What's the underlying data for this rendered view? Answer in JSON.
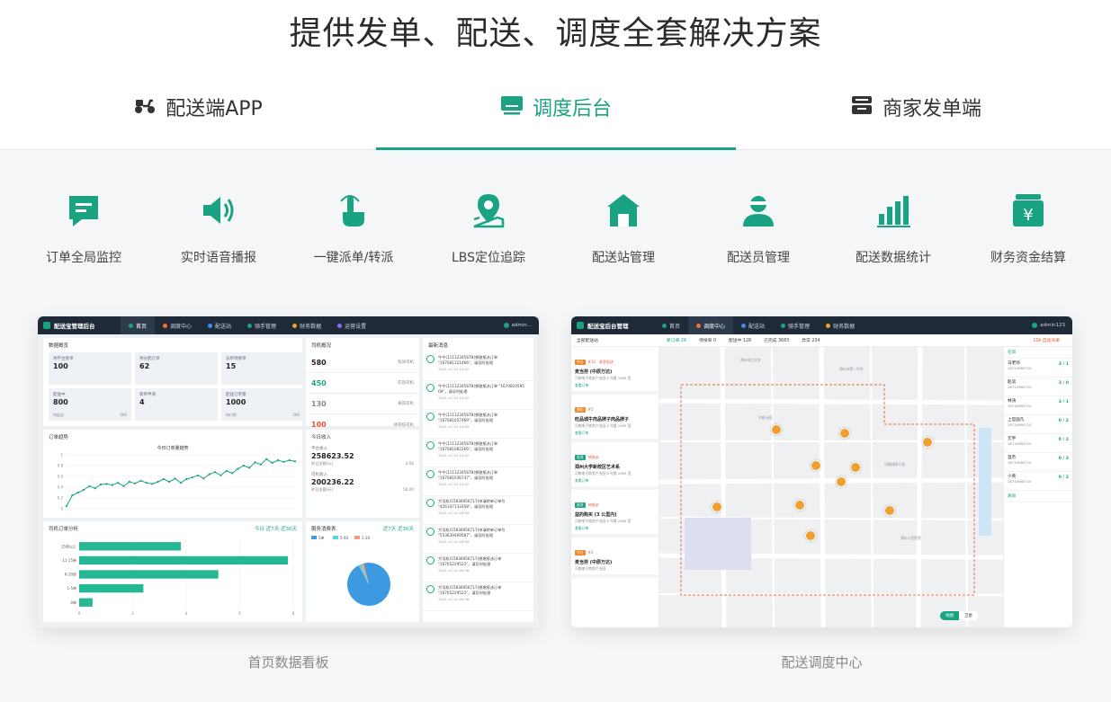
{
  "hero": {
    "title": "提供发单、配送、调度全套解决方案"
  },
  "tabs": [
    {
      "label": "配送端APP",
      "icon": "scooter-icon",
      "active": false
    },
    {
      "label": "调度后台",
      "icon": "monitor-icon",
      "active": true
    },
    {
      "label": "商家发单端",
      "icon": "register-icon",
      "active": false
    }
  ],
  "colors": {
    "accent": "#1aa383",
    "dark_nav": "#1f2a38",
    "orange": "#f0a030"
  },
  "features": [
    {
      "label": "订单全局监控",
      "icon": "order-doc-icon"
    },
    {
      "label": "实时语音播报",
      "icon": "speaker-icon"
    },
    {
      "label": "一键派单/转派",
      "icon": "tap-hand-icon"
    },
    {
      "label": "LBS定位追踪",
      "icon": "location-pin-icon"
    },
    {
      "label": "配送站管理",
      "icon": "station-house-icon"
    },
    {
      "label": "配送员管理",
      "icon": "courier-avatar-icon"
    },
    {
      "label": "配送数据统计",
      "icon": "bar-stats-icon"
    },
    {
      "label": "财务资金结算",
      "icon": "wallet-yen-icon"
    }
  ],
  "screenshots": {
    "dashboard": {
      "caption": "首页数据看板",
      "appbar": {
        "brand": "配送宝管理后台",
        "nav": [
          "首页",
          "调度中心",
          "配送站",
          "骑手管理",
          "财务数据",
          "运营设置"
        ],
        "user": "admin..."
      },
      "overview": {
        "title": "数据概览",
        "kpis": [
          {
            "label": "待平台接单",
            "value": "100"
          },
          {
            "label": "待分配订单",
            "value": "62"
          },
          {
            "label": "派单待接单",
            "value": "15"
          },
          {
            "label": "配送中",
            "value": "800",
            "sub_l": "待配送",
            "sub_r": "600"
          },
          {
            "label": "转单申请",
            "value": "4"
          },
          {
            "label": "配送订单量",
            "value": "1000",
            "sub_l": "待付款",
            "sub_r": "200"
          }
        ]
      },
      "drivers": {
        "title": "司机概况",
        "rows": [
          {
            "value": "580",
            "label": "有效司机",
            "color": "#222222"
          },
          {
            "value": "450",
            "label": "在岗司机",
            "color": "#1aa383"
          },
          {
            "value": "130",
            "label": "离岗司机",
            "color": "#888888"
          },
          {
            "value": "100",
            "label": "待审核司机",
            "color": "#e8552e"
          }
        ]
      },
      "messages": {
        "title": "最新消息",
        "items": [
          {
            "text": "牛牛(11112345678)想邀报派订单 \"167081121466\"，请及时处理",
            "date": "2022-12-12 10:12"
          },
          {
            "text": "牛牛(11112345678)想邀报派订单 \"1670810595 09\"，请及时处理",
            "date": "2022-12-12 10:12"
          },
          {
            "text": "牛牛(11112345678)想邀报派订单 \"167081057469\"，请及时处理",
            "date": "2022-12-12 10:05"
          },
          {
            "text": "牛牛(11112345678)想邀报派订单 \"167081082266\"，请及时处理",
            "date": "2022-12-12 10:02"
          },
          {
            "text": "牛牛(11112345678)想邀报派订单 \"167081036747\"，请及时处理",
            "date": "2022-12-12 10:02"
          },
          {
            "text": "大司机(15836956717)申请转单订单号 \"426107133358\"，请及时处理",
            "date": "2022-12-12 09:50"
          },
          {
            "text": "大司机(15836956717)申请转单订单号 \"553639409587\"，请及时处理",
            "date": "2022-12-12 09:50"
          },
          {
            "text": "大司机(15836956717)想邀报派订单 \"16705229522\"，请及时处理",
            "date": "2022-12-12 09:08"
          },
          {
            "text": "大司机(15836956717)想邀报派订单 \"16705229522\"，请及时处理",
            "date": "2022-12-12 09:08"
          }
        ]
      },
      "trend": {
        "title": "订单趋势",
        "chart_title": "今日订单量趋势",
        "y_ticks": [
          "1",
          "0.8",
          "0.6",
          "0.4",
          "0.2",
          "0"
        ]
      },
      "finance": {
        "title": "今日收入",
        "platform_label": "平台收入",
        "platform_value": "258623.52",
        "platform_sub_l": "昨日金额(元)",
        "platform_sub_r": "4.56",
        "driver_label": "司机收入",
        "driver_value": "200236.22",
        "driver_sub_l": "昨日金额(元)",
        "driver_sub_r": "56.00"
      },
      "driver_rank": {
        "title": "司机订单分析",
        "filters": "今日 近7天 近30天",
        "categories": [
          "15单以上",
          "11-15单",
          "6-10单",
          "1-5单",
          "0单"
        ],
        "x_ticks": [
          "0",
          "2",
          "4",
          "6",
          "8"
        ]
      },
      "service_fee": {
        "title": "服务消费表",
        "filters": "近7天 近30天",
        "legend": [
          "5单",
          "5-40",
          "1-20"
        ]
      }
    },
    "dispatch": {
      "caption": "配送调度中心",
      "appbar": {
        "brand": "配送宝后台管理",
        "nav": [
          "首页",
          "调度中心",
          "配送站",
          "骑手管理",
          "财务数据"
        ],
        "user": "admin123"
      },
      "toolbar": {
        "site": "全部配送站",
        "stats": [
          "新订单 26",
          "待接单 0",
          "配送中 128",
          "已完成 3683",
          "异常 234"
        ],
        "auto": "10k 自动派单"
      },
      "orders": [
        {
          "tag": "今日",
          "head": "#12 · 紧急配送",
          "name": "麦当劳 (中原万达)",
          "addr": "河南电子商务产业园 8 号楼 1605 室",
          "foot": "查看订单"
        },
        {
          "tag": "预约",
          "head": "#5",
          "name": "旺品城牛肉品牌子肉品牌子",
          "addr": "河南电子商务产业园 6 号楼 1605 室",
          "foot": "查看订单"
        },
        {
          "tag": "直发",
          "head": "待指派",
          "name": "郑州大学新校区艺术系",
          "addr": "河南电子商务产业园 6 号楼 1605 室",
          "foot": "查看订单"
        },
        {
          "tag": "直发",
          "head": "待指派",
          "name": "益的购买 (3 公里内)",
          "addr": "河南电子商务产业园 6 号楼 1605 室",
          "foot": "查看订单"
        },
        {
          "tag": "今日",
          "head": "#2",
          "name": "麦当劳 (中原万达)",
          "addr": "河南电子商务产业园",
          "foot": ""
        }
      ],
      "riders": {
        "section_online": "在岗",
        "section_offline": "离岗",
        "list": [
          {
            "name": "马老师",
            "phone": "18710980710",
            "count": "3 / 1"
          },
          {
            "name": "赵滨",
            "phone": "18710980710",
            "count": "3 / 0"
          },
          {
            "name": "林涛",
            "phone": "18710980710",
            "count": "3 / 1"
          },
          {
            "name": "上官画凡",
            "phone": "18710980710",
            "count": "0 / 2"
          },
          {
            "name": "元宇",
            "phone": "18710980710",
            "count": "0 / 2"
          },
          {
            "name": "温杰",
            "phone": "18710980710",
            "count": "0 / 3"
          },
          {
            "name": "小英",
            "phone": "18710980710",
            "count": "0 / 2"
          }
        ]
      },
      "map_labels": [
        "郑州电力大学",
        "中原公园",
        "郑州市第一中学",
        "河南财政干部",
        "郑州人民医院"
      ],
      "map_buttons": [
        "地图",
        "卫星"
      ]
    }
  },
  "chart_data": [
    {
      "type": "line",
      "title": "今日订单量趋势",
      "x": [
        0,
        1,
        2,
        3,
        4,
        5,
        6,
        7,
        8,
        9,
        10,
        11,
        12,
        13,
        14,
        15,
        16,
        17,
        18,
        19,
        20,
        21,
        22,
        23,
        24,
        25,
        26,
        27,
        28,
        29,
        30,
        31,
        32,
        33,
        34,
        35,
        36,
        37,
        38,
        39,
        40
      ],
      "values": [
        0.05,
        0.25,
        0.3,
        0.35,
        0.42,
        0.38,
        0.45,
        0.46,
        0.44,
        0.48,
        0.42,
        0.5,
        0.47,
        0.52,
        0.48,
        0.46,
        0.5,
        0.55,
        0.5,
        0.56,
        0.48,
        0.55,
        0.58,
        0.62,
        0.56,
        0.64,
        0.68,
        0.62,
        0.7,
        0.66,
        0.74,
        0.8,
        0.76,
        0.86,
        0.82,
        0.92,
        0.85,
        0.9,
        0.87,
        0.9,
        0.88
      ],
      "ylim": [
        0,
        1
      ]
    },
    {
      "type": "bar",
      "title": "司机订单分析",
      "categories": [
        "15单以上",
        "11-15单",
        "6-10单",
        "1-5单",
        "0单"
      ],
      "values": [
        3.8,
        7.8,
        5.2,
        2.4,
        0.5
      ],
      "xlim": [
        0,
        8
      ]
    },
    {
      "type": "pie",
      "title": "服务消费表",
      "categories": [
        "5单",
        "5-40",
        "1-20"
      ],
      "values": [
        96,
        2,
        2
      ]
    }
  ]
}
